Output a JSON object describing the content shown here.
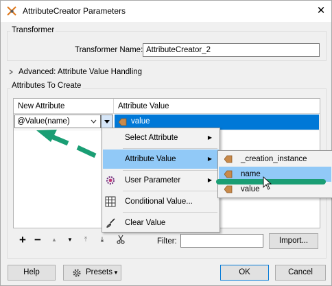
{
  "window": {
    "title": "AttributeCreator Parameters",
    "close_glyph": "✕"
  },
  "transformer": {
    "group_label": "Transformer",
    "name_label": "Transformer Name:",
    "name_value": "AttributeCreator_2"
  },
  "advanced": {
    "label": "Advanced: Attribute Value Handling"
  },
  "attributes": {
    "group_label": "Attributes To Create",
    "columns": [
      "New Attribute",
      "Attribute Value"
    ],
    "row": {
      "new_attribute": "@Value(name)",
      "attribute_value": "value"
    }
  },
  "context_menu": {
    "items": [
      {
        "label": "Select Attribute",
        "icon": "none",
        "submenu": true
      },
      {
        "label": "Attribute Value",
        "icon": "none",
        "submenu": true,
        "highlighted": true
      },
      {
        "label": "User Parameter",
        "icon": "user-parameter-icon",
        "submenu": true
      },
      {
        "label": "Conditional Value...",
        "icon": "table-grid-icon",
        "submenu": false
      },
      {
        "label": "Clear Value",
        "icon": "broom-icon",
        "submenu": false
      }
    ]
  },
  "submenu": {
    "items": [
      {
        "label": "_creation_instance",
        "icon": "attribute-arrow-icon"
      },
      {
        "label": "name",
        "icon": "attribute-arrow-icon",
        "highlighted": true
      },
      {
        "label": "value",
        "icon": "attribute-arrow-icon"
      }
    ]
  },
  "toolbar": {
    "add": "+",
    "remove": "−",
    "move_up": "▲",
    "move_down": "▼",
    "move_top": "⤒",
    "move_bottom": "⤓",
    "filter_label": "Filter:",
    "filter_value": "",
    "import_label": "Import..."
  },
  "footer": {
    "help": "Help",
    "presets": "Presets",
    "ok": "OK",
    "cancel": "Cancel"
  },
  "colors": {
    "accent": "#0078d7",
    "arrow_green": "#1a9e74",
    "attr_icon": "#c98a4b"
  }
}
